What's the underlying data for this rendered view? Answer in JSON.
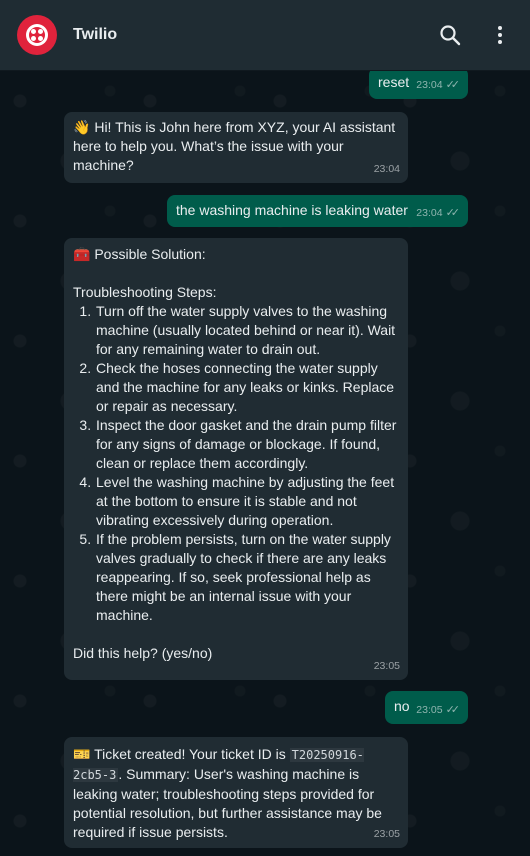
{
  "app": {
    "title": "Twilio"
  },
  "icons": {
    "search": "search-icon",
    "menu": "more-vertical-icon",
    "logo": "twilio-logo",
    "read_receipt": "double-check-icon"
  },
  "colors": {
    "header": "#1f2c33",
    "background": "#0b141a",
    "outgoing": "#005c4b",
    "incoming": "#202c33",
    "brand": "#e0233c"
  },
  "messages": {
    "m1": {
      "text": "reset",
      "time": "23:04"
    },
    "m2": {
      "emoji": "👋",
      "text": "Hi! This is John here from XYZ, your AI assistant here to help you. What’s the issue with your machine?",
      "time": "23:04"
    },
    "m3": {
      "text": "the washing machine is leaking water",
      "time": "23:04"
    },
    "m4": {
      "emoji": "🧰",
      "heading": "Possible Solution:",
      "subheading": "Troubleshooting Steps:",
      "steps": [
        "Turn off the water supply valves to the washing machine (usually located behind or near it). Wait for any remaining water to drain out.",
        "Check the hoses connecting the water supply and the machine for any leaks or kinks. Replace or repair as necessary.",
        "Inspect the door gasket and the drain pump filter for any signs of damage or blockage. If found, clean or replace them accordingly.",
        "Level the washing machine by adjusting the feet at the bottom to ensure it is stable and not vibrating excessively during operation.",
        "If the problem persists, turn on the water supply valves gradually to check if there are any leaks reappearing. If so, seek professional help as there might be an internal issue with your machine."
      ],
      "question": "Did this help? (yes/no)",
      "time": "23:05"
    },
    "m5": {
      "text": "no",
      "time": "23:05"
    },
    "m6": {
      "emoji": "🎫",
      "text_before": "Ticket created! Your ticket ID is",
      "ticket_id": "T20250916-2cb5-3",
      "text_after": ". Summary: User's washing machine is leaking water; troubleshooting steps provided for potential resolution, but further assistance may be required if issue persists.",
      "time": "23:05"
    }
  }
}
